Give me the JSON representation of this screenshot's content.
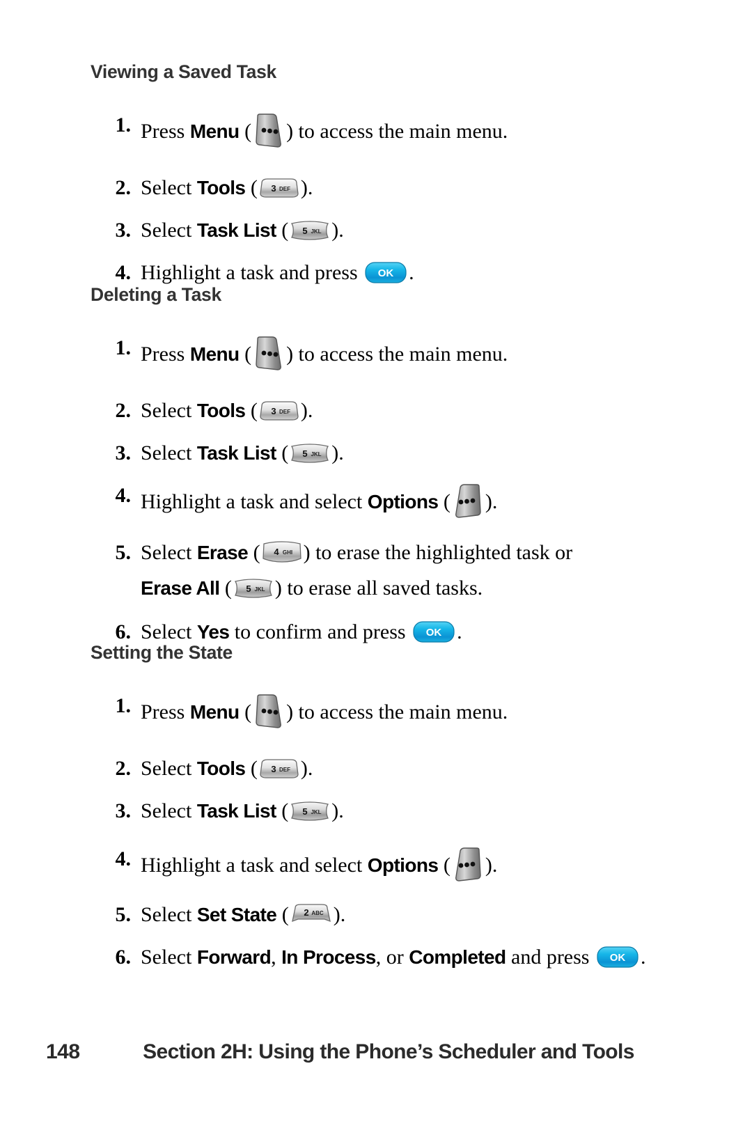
{
  "page": {
    "number": "148",
    "footer_title": "Section 2H: Using the Phone’s Scheduler and Tools"
  },
  "icons": {
    "ok_label": "OK",
    "key_2": {
      "digit": "2",
      "letters": "ABC"
    },
    "key_3": {
      "digit": "3",
      "letters": "DEF"
    },
    "key_4": {
      "digit": "4",
      "letters": "GHI"
    },
    "key_5": {
      "digit": "5",
      "letters": "JKL"
    },
    "softkey_left": "menu-softkey-icon",
    "softkey_right": "options-softkey-icon"
  },
  "sections": [
    {
      "heading": "Viewing a Saved Task",
      "steps": [
        {
          "num": "1.",
          "pre": "Press ",
          "bold": "Menu",
          "mid": " (",
          "icon": "softkey-left",
          "post": ") to access the main menu."
        },
        {
          "num": "2.",
          "pre": "Select ",
          "bold": "Tools",
          "mid": " (",
          "icon": "key-3",
          "post": ")."
        },
        {
          "num": "3.",
          "pre": "Select ",
          "bold": "Task List",
          "mid": " (",
          "icon": "key-5",
          "post": ")."
        },
        {
          "num": "4.",
          "pre": "Highlight a task and press ",
          "bold": "",
          "mid": "",
          "icon": "ok",
          "post": "."
        }
      ]
    },
    {
      "heading": "Deleting a Task",
      "steps": [
        {
          "num": "1.",
          "pre": "Press ",
          "bold": "Menu",
          "mid": " (",
          "icon": "softkey-left",
          "post": ") to access the main menu."
        },
        {
          "num": "2.",
          "pre": "Select ",
          "bold": "Tools",
          "mid": " (",
          "icon": "key-3",
          "post": ")."
        },
        {
          "num": "3.",
          "pre": "Select ",
          "bold": "Task List",
          "mid": " (",
          "icon": "key-5",
          "post": ")."
        },
        {
          "num": "4.",
          "pre": "Highlight a task and select ",
          "bold": "Options",
          "mid": " (",
          "icon": "softkey-right",
          "post": ")."
        },
        {
          "num": "5.",
          "pre": "Select ",
          "bold": "Erase",
          "mid": " (",
          "icon": "key-4",
          "post": ") to erase the highlighted task or",
          "line2_bold": "Erase All",
          "line2_mid": " (",
          "line2_icon": "key-5",
          "line2_post": ") to erase all saved tasks."
        },
        {
          "num": "6.",
          "pre": "Select ",
          "bold": "Yes",
          "mid": " to confirm and press ",
          "icon": "ok",
          "post": "."
        }
      ]
    },
    {
      "heading": "Setting the State",
      "steps": [
        {
          "num": "1.",
          "pre": "Press ",
          "bold": "Menu",
          "mid": " (",
          "icon": "softkey-left",
          "post": ") to access the main menu."
        },
        {
          "num": "2.",
          "pre": "Select ",
          "bold": "Tools",
          "mid": " (",
          "icon": "key-3",
          "post": ")."
        },
        {
          "num": "3.",
          "pre": "Select ",
          "bold": "Task List",
          "mid": " (",
          "icon": "key-5",
          "post": ")."
        },
        {
          "num": "4.",
          "pre": "Highlight a task and select ",
          "bold": "Options",
          "mid": " (",
          "icon": "softkey-right",
          "post": ")."
        },
        {
          "num": "5.",
          "pre": "Select ",
          "bold": "Set State",
          "mid": " (",
          "icon": "key-2",
          "post": ")."
        },
        {
          "num": "6.",
          "pre": "Select ",
          "bold": "Forward",
          "mid": ", ",
          "bold2": "In Process",
          "mid2": ", or ",
          "bold3": "Completed",
          "mid3": " and press ",
          "icon": "ok",
          "post": "."
        }
      ]
    }
  ]
}
